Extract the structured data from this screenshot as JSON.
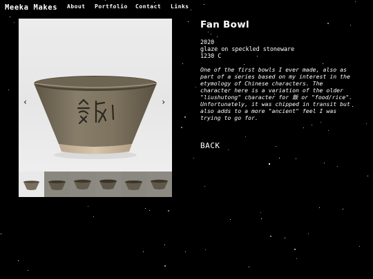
{
  "site": {
    "brand": "Meeka Makes"
  },
  "nav": {
    "about": "About",
    "portfolio": "Portfolio",
    "contact": "Contact",
    "links": "Links"
  },
  "gallery": {
    "prev_icon": "chevron-left-icon",
    "next_icon": "chevron-right-icon",
    "prev_glyph": "‹",
    "next_glyph": "›"
  },
  "piece": {
    "title": "Fan Bowl",
    "year": "2020",
    "material": "glaze on speckled stoneware",
    "temperature": "1230 C",
    "description": "One of the first bowls I ever made, also as part of a series based on my interest in the etymology of Chinese characters. The character here is a variation of the older \"liushutong\" character for 飯 or \"food/rice\". Unfortunately, it was chipped in transit but also adds to a more \"ancient\" feel I was trying to go for."
  },
  "back_label": "BACK",
  "colors": {
    "background": "#000000",
    "text": "#ffffff",
    "glaze": "#7f7562"
  }
}
